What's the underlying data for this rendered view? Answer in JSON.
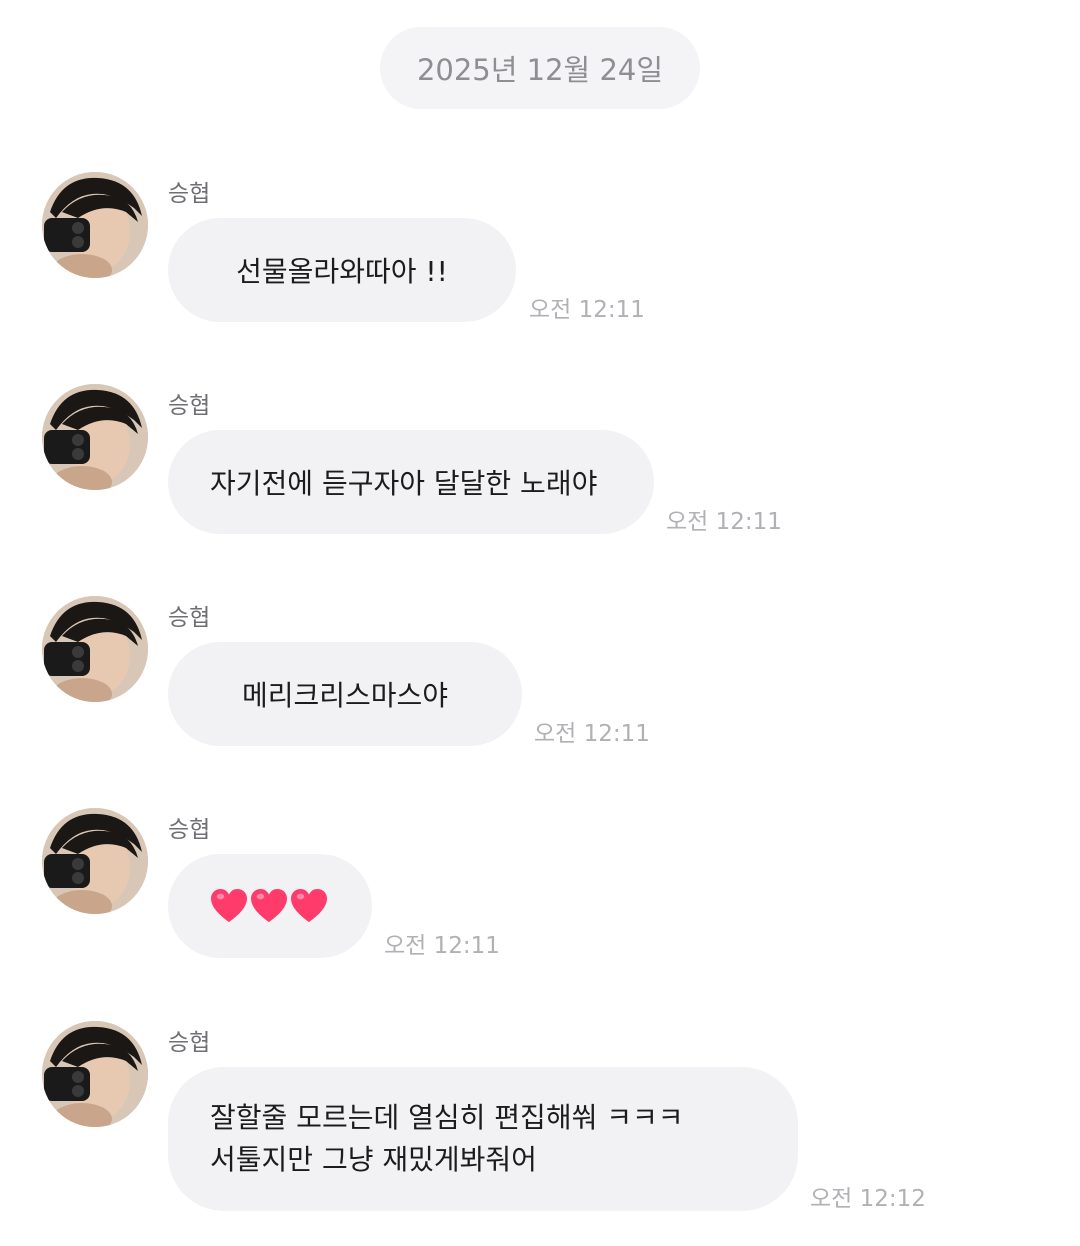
{
  "date_divider": "2025년 12월 24일",
  "messages": [
    {
      "sender": "승협",
      "text": "선물올라와따아 !!",
      "time": "오전 12:11"
    },
    {
      "sender": "승협",
      "text": "자기전에 듣구자아 달달한 노래야",
      "time": "오전 12:11"
    },
    {
      "sender": "승협",
      "text": "메리크리스마스야",
      "time": "오전 12:11"
    },
    {
      "sender": "승협",
      "emoji": "❤️❤️❤️",
      "time": "오전 12:11"
    },
    {
      "sender": "승협",
      "lines": [
        "잘할줄 모르는데 열심히 편집해쒀 ㅋㅋㅋ",
        "서툴지만 그냥 재밌게봐줘어"
      ],
      "time": "오전 12:12"
    }
  ],
  "colors": {
    "bubble": "#f2f2f4",
    "heart": "#ff3b6b"
  }
}
